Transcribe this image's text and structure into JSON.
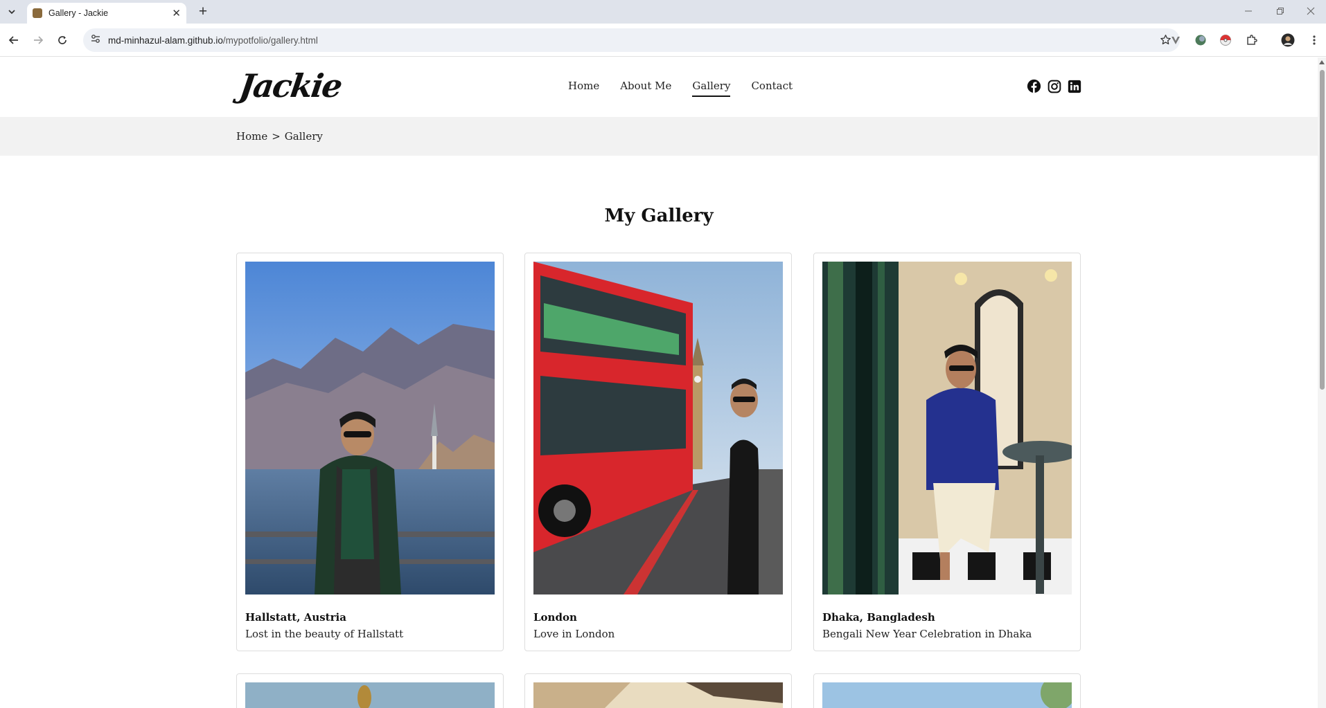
{
  "browser": {
    "tab_title": "Gallery - Jackie",
    "url_host": "md-minhazul-alam.github.io",
    "url_path": "/mypotfolio/gallery.html"
  },
  "site": {
    "logo": "Jackie",
    "nav": [
      "Home",
      "About Me",
      "Gallery",
      "Contact"
    ],
    "active_nav": "Gallery",
    "social_icons": [
      "facebook-icon",
      "instagram-icon",
      "linkedin-icon"
    ]
  },
  "breadcrumb": {
    "home": "Home",
    "separator": ">",
    "current": "Gallery"
  },
  "gallery": {
    "heading": "My Gallery",
    "items": [
      {
        "title": "Hallstatt, Austria",
        "description": "Lost in the beauty of Hallstatt"
      },
      {
        "title": "London",
        "description": "Love in London"
      },
      {
        "title": "Dhaka, Bangladesh",
        "description": "Bengali New Year Celebration in Dhaka"
      }
    ]
  },
  "colors": {
    "accent": "#111111",
    "breadcrumb_bg": "#f2f2f2",
    "bus_red": "#d8262c"
  }
}
